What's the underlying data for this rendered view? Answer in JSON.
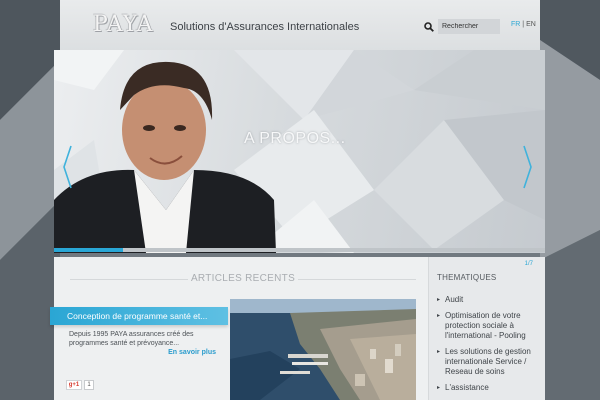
{
  "header": {
    "logo": "PAYA",
    "tagline": "Solutions d'Assurances Internationales",
    "search": {
      "placeholder": "Rechercher",
      "icon": "search-icon"
    },
    "languages": {
      "active": "FR",
      "separator": "|",
      "other": "EN"
    }
  },
  "slider": {
    "caption": "A PROPOS...",
    "prev_icon": "chevron-left-icon",
    "next_icon": "chevron-right-icon",
    "progress_fraction": 0.14
  },
  "articles": {
    "title": "ARTICLES RECENTS",
    "items": [
      {
        "title": "Conception de programme santé et...",
        "excerpt": "Depuis 1995 PAYA assurances créé des programmes santé et prévoyance...",
        "read_more": "En savoir plus",
        "share_label": "g+1",
        "share_count": "1"
      }
    ]
  },
  "themes": {
    "counter": "1/7",
    "title": "THEMATIQUES",
    "items": [
      "Audit",
      "Optimisation de votre protection sociale à l'international - Pooling",
      "Les solutions de gestion internationale Service / Reseau de soins",
      "L'assistance"
    ]
  },
  "colors": {
    "accent": "#29a7d6",
    "header_bg": "#e4e6e8",
    "page_bg": "#6f767c"
  }
}
